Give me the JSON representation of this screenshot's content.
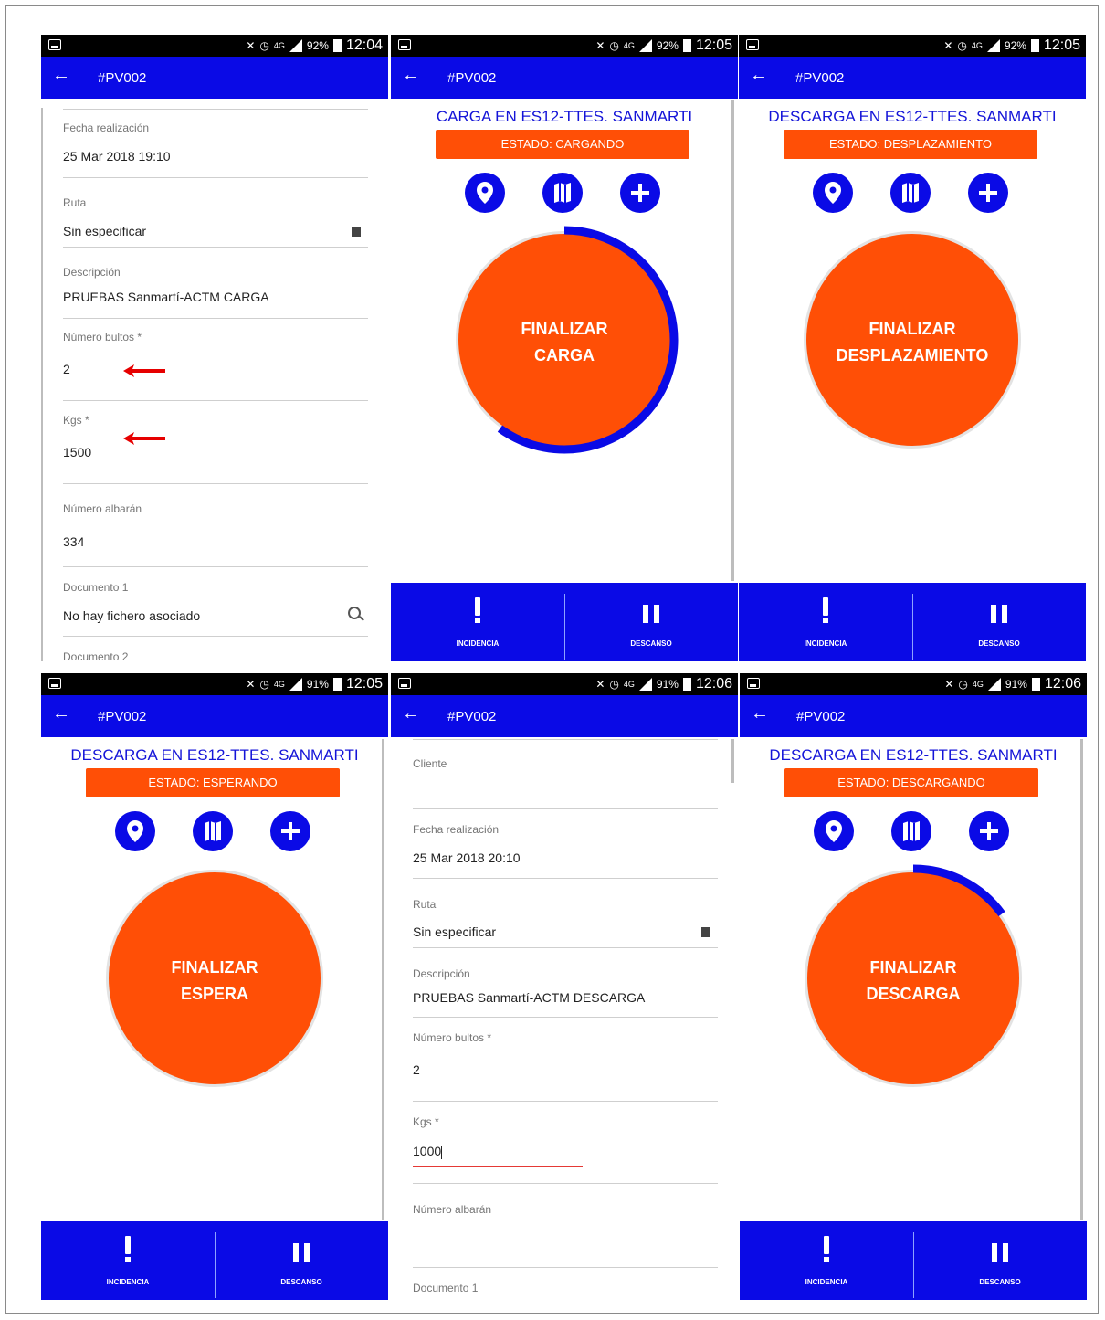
{
  "status_bars": [
    {
      "signal": "4G",
      "battery": "92%",
      "time": "12:04"
    },
    {
      "signal": "4G",
      "battery": "92%",
      "time": "12:05"
    },
    {
      "signal": "4G",
      "battery": "92%",
      "time": "12:05"
    },
    {
      "signal": "4G",
      "battery": "91%",
      "time": "12:05"
    },
    {
      "signal": "4G",
      "battery": "91%",
      "time": "12:06"
    },
    {
      "signal": "4G",
      "battery": "91%",
      "time": "12:06"
    }
  ],
  "appbar": {
    "title": "#PV002"
  },
  "form1": {
    "fecha_label": "Fecha realización",
    "fecha_value": "25 Mar 2018 19:10",
    "ruta_label": "Ruta",
    "ruta_value": "Sin especificar",
    "descripcion_label": "Descripción",
    "descripcion_value": "PRUEBAS Sanmartí-ACTM CARGA",
    "bultos_label": "Número bultos *",
    "bultos_value": "2",
    "kgs_label": "Kgs *",
    "kgs_value": "1500",
    "albaran_label": "Número albarán",
    "albaran_value": "334",
    "doc1_label": "Documento 1",
    "doc1_value": "No hay fichero asociado",
    "doc2_label": "Documento 2"
  },
  "screen_carga": {
    "title": "CARGA EN ES12-TTES. SANMARTI",
    "estado": "ESTADO: CARGANDO",
    "big_line1": "FINALIZAR",
    "big_line2": "CARGA",
    "progress": 0.6
  },
  "screen_desplazamiento": {
    "title": "DESCARGA EN ES12-TTES. SANMARTI",
    "estado": "ESTADO: DESPLAZAMIENTO",
    "big_line1": "FINALIZAR",
    "big_line2": "DESPLAZAMIENTO",
    "progress": 0
  },
  "screen_espera": {
    "title": "DESCARGA EN ES12-TTES. SANMARTI",
    "estado": "ESTADO: ESPERANDO",
    "big_line1": "FINALIZAR",
    "big_line2": "ESPERA",
    "progress": 0
  },
  "form2": {
    "cliente_label": "Cliente",
    "fecha_label": "Fecha realización",
    "fecha_value": "25 Mar 2018 20:10",
    "ruta_label": "Ruta",
    "ruta_value": "Sin especificar",
    "descripcion_label": "Descripción",
    "descripcion_value": "PRUEBAS Sanmartí-ACTM DESCARGA",
    "bultos_label": "Número bultos *",
    "bultos_value": "2",
    "kgs_label": "Kgs *",
    "kgs_value": "1000",
    "albaran_label": "Número albarán",
    "doc1_label": "Documento 1"
  },
  "screen_descarga": {
    "title": "DESCARGA EN ES12-TTES. SANMARTI",
    "estado": "ESTADO: DESCARGANDO",
    "big_line1": "FINALIZAR",
    "big_line2": "DESCARGA",
    "progress": 0.15
  },
  "bottom": {
    "incidencia": "INCIDENCIA",
    "descanso": "DESCANSO"
  },
  "colors": {
    "primary_blue": "#0a0ae6",
    "accent_orange": "#ff4f06",
    "title_blue": "#1414d8",
    "arrow_red": "#e60000"
  },
  "icons": [
    "location-pin-icon",
    "map-icon",
    "add-icon",
    "exclamation-icon",
    "pause-icon",
    "back-arrow-icon",
    "search-icon"
  ]
}
